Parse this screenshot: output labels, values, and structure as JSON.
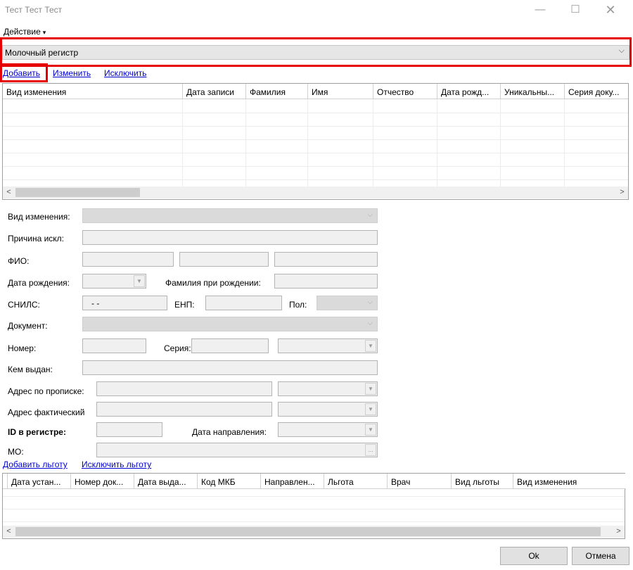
{
  "window": {
    "title": "Тест Тест Тест",
    "minimize": "—",
    "maximize": "☐",
    "close": "✕"
  },
  "menu": {
    "action_label": "Действие",
    "caret": "▾"
  },
  "register": {
    "selected": "Молочный регистр",
    "arrow": "⌵"
  },
  "toolbar": {
    "add": "Добавить",
    "edit": "Изменить",
    "exclude": "Исключить"
  },
  "main_grid": {
    "columns": [
      "Вид изменения",
      "Дата записи",
      "Фамилия",
      "Имя",
      "Отчество",
      "Дата рожд...",
      "Уникальны...",
      "Серия доку..."
    ]
  },
  "form": {
    "change_type_label": "Вид изменения:",
    "exclude_reason_label": "Причина искл:",
    "fio_label": "ФИО:",
    "birth_date_label": "Дата рождения:",
    "birth_surname_label": "Фамилия при рождении:",
    "snils_label": "СНИЛС:",
    "snils_value": "-   -",
    "enp_label": "ЕНП:",
    "sex_label": "Пол:",
    "document_label": "Документ:",
    "number_label": "Номер:",
    "series_label": "Серия:",
    "issued_by_label": "Кем выдан:",
    "reg_address_label": "Адрес по прописке:",
    "fact_address_label": "Адрес фактический",
    "registry_id_label": "ID в регистре:",
    "referral_date_label": "Дата направления:",
    "mo_label": "МО:",
    "mo_button": "..."
  },
  "benefits": {
    "add": "Добавить льготу",
    "exclude": "Исключить льготу"
  },
  "benefit_grid": {
    "columns": [
      "Дата устан...",
      "Номер док...",
      "Дата выда...",
      "Код МКБ",
      "Направлен...",
      "Льгота",
      "Врач",
      "Вид льготы",
      "Вид изменения"
    ]
  },
  "scroll": {
    "left": "<",
    "right": ">"
  },
  "buttons": {
    "ok": "Ok",
    "cancel": "Отмена"
  }
}
